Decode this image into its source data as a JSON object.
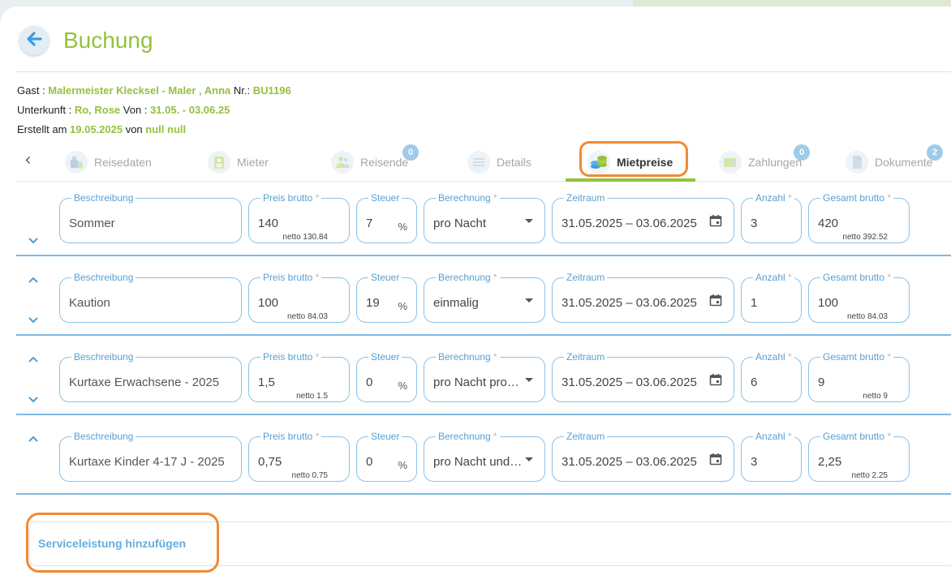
{
  "header": {
    "title": "Buchung"
  },
  "info": {
    "guest_label": "Gast : ",
    "guest_value": "Malermeister Klecksel - Maler , Anna",
    "nr_label": " Nr.: ",
    "nr_value": "BU1196",
    "accom_label": "Unterkunft : ",
    "accom_value": "Ro, Rose",
    "von_label": " Von : ",
    "von_value": "31.05. - 03.06.25",
    "created_label": "Erstellt am ",
    "created_value": "19.05.2025",
    "by_label": " von ",
    "by_value": "null null"
  },
  "tabs": [
    {
      "label": "Reisedaten",
      "icon": "luggage-icon"
    },
    {
      "label": "Mieter",
      "icon": "id-card-icon"
    },
    {
      "label": "Reisende",
      "icon": "people-icon",
      "badge": "0"
    },
    {
      "label": "Details",
      "icon": "list-icon"
    },
    {
      "label": "Mietpreise",
      "icon": "coins-icon",
      "active": true
    },
    {
      "label": "Zahlungen",
      "icon": "wallet-icon",
      "badge": "0"
    },
    {
      "label": "Dokumente",
      "icon": "document-icon",
      "badge": "2"
    }
  ],
  "field_labels": {
    "beschreibung": "Beschreibung",
    "preis": "Preis brutto",
    "steuer": "Steuer",
    "berechnung": "Berechnung",
    "zeitraum": "Zeitraum",
    "anzahl": "Anzahl",
    "gesamt": "Gesamt brutto",
    "required_mark": " *",
    "percent": "%"
  },
  "rows": [
    {
      "beschreibung": "Sommer",
      "preis": "140",
      "preis_netto": "netto 130.84",
      "steuer": "7",
      "berechnung": "pro Nacht",
      "zeitraum": "31.05.2025 – 03.06.2025",
      "anzahl": "3",
      "gesamt": "420",
      "gesamt_netto": "netto 392.52"
    },
    {
      "beschreibung": "Kaution",
      "preis": "100",
      "preis_netto": "netto 84.03",
      "steuer": "19",
      "berechnung": "einmalig",
      "zeitraum": "31.05.2025 – 03.06.2025",
      "anzahl": "1",
      "gesamt": "100",
      "gesamt_netto": "netto 84.03"
    },
    {
      "beschreibung": "Kurtaxe Erwachsene - 2025",
      "preis": "1,5",
      "preis_netto": "netto 1.5",
      "steuer": "0",
      "berechnung": "pro Nacht pro Person",
      "zeitraum": "31.05.2025 – 03.06.2025",
      "anzahl": "6",
      "gesamt": "9",
      "gesamt_netto": "netto 9"
    },
    {
      "beschreibung": "Kurtaxe Kinder 4-17 J - 2025",
      "preis": "0,75",
      "preis_netto": "netto 0.75",
      "steuer": "0",
      "berechnung": "pro Nacht und Person",
      "zeitraum": "31.05.2025 – 03.06.2025",
      "anzahl": "3",
      "gesamt": "2,25",
      "gesamt_netto": "netto 2.25"
    }
  ],
  "service": {
    "add_label": "Serviceleistung hinzufügen"
  },
  "colors": {
    "accent_green": "#94c23c",
    "accent_blue": "#5a9fd0",
    "highlight_orange": "#f08a32"
  }
}
